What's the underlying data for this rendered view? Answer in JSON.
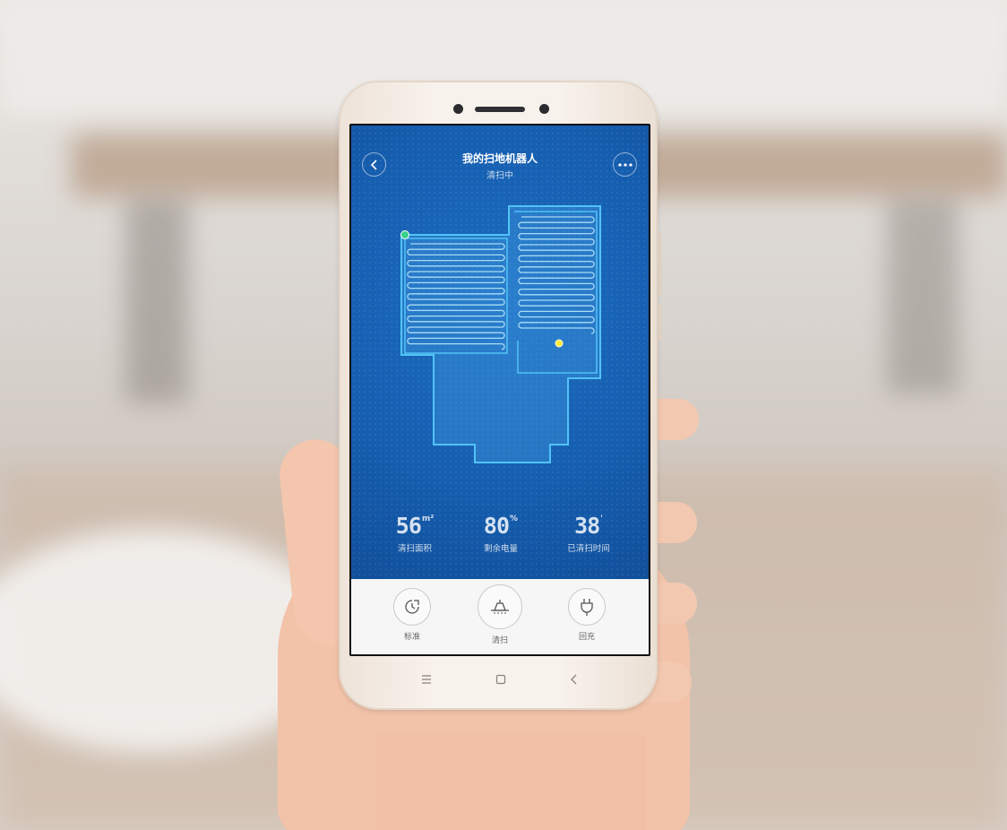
{
  "app": {
    "title": "我的扫地机器人",
    "subtitle": "清扫中"
  },
  "header": {
    "back_icon": "chevron-left-icon",
    "more_icon": "more-dots-icon"
  },
  "map": {
    "colors": {
      "background": "#165fb1",
      "walls": "#52c3f7",
      "cleaned_paths": "#a9dcf6",
      "charging_dock": "#39d08a",
      "robot": "#ffeb3b"
    }
  },
  "stats": [
    {
      "value": "56",
      "unit": "m²",
      "label": "清扫面积"
    },
    {
      "value": "80",
      "unit": "%",
      "label": "剩余电量"
    },
    {
      "value": "38",
      "unit": "'",
      "label": "已清扫时间"
    }
  ],
  "controls": [
    {
      "label": "标准",
      "icon": "fan-speed-icon"
    },
    {
      "label": "清扫",
      "icon": "sweep-icon"
    },
    {
      "label": "回充",
      "icon": "charge-plug-icon"
    }
  ],
  "nav_bar": {
    "menu_icon": "menu-icon",
    "home_icon": "home-square-icon",
    "back_icon": "back-arrow-icon"
  }
}
